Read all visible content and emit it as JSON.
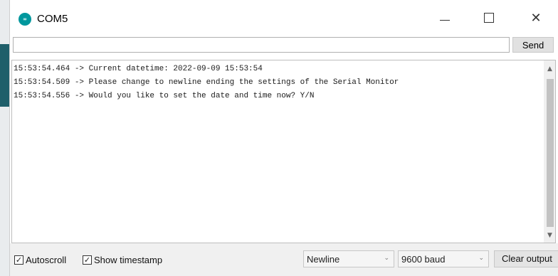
{
  "window": {
    "title": "COM5",
    "app_icon_text": "∞",
    "minimize_glyph": "",
    "close_glyph": "✕"
  },
  "send": {
    "input_value": "",
    "button_label": "Send"
  },
  "output": {
    "lines": [
      "15:53:54.464 -> Current datetime: 2022-09-09 15:53:54",
      "15:53:54.509 -> Please change to newline ending the settings of the Serial Monitor",
      "15:53:54.556 -> Would you like to set the date and time now? Y/N"
    ]
  },
  "scrollbar": {
    "up_arrow": "▲",
    "down_arrow": "▼"
  },
  "bottombar": {
    "autoscroll_label": "Autoscroll",
    "autoscroll_checked": true,
    "timestamp_label": "Show timestamp",
    "timestamp_checked": true,
    "check_glyph": "✓",
    "line_ending_value": "Newline",
    "baud_value": "9600 baud",
    "dropdown_glyph": "⌄",
    "clear_label": "Clear output"
  },
  "colors": {
    "arduino_teal": "#00979d",
    "side_accent": "#1f5f6a"
  }
}
